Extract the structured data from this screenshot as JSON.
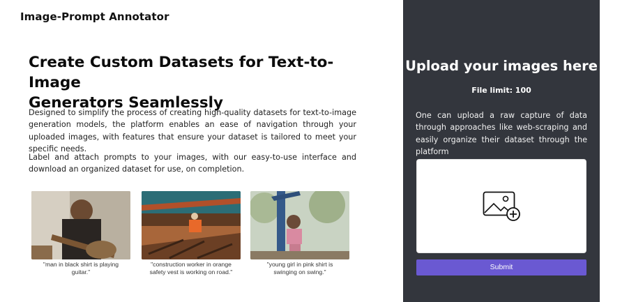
{
  "app": {
    "title": "Image-Prompt Annotator"
  },
  "hero": {
    "headline_line1": "Create Custom Datasets for Text-to-Image",
    "headline_line2": "Generators Seamlessly",
    "paragraph1": "Designed to simplify the process of creating high-quality datasets for text-to-image generation models, the platform enables an ease of navigation through your uploaded images, with features that ensure your dataset is tailored to meet your specific needs.",
    "paragraph2": "Label and attach prompts to your images, with our easy-to-use interface and download an organized dataset for use, on completion."
  },
  "examples": [
    {
      "caption_line1": "\"man in black shirt is playing",
      "caption_line2": "guitar.\""
    },
    {
      "caption_line1": "\"construction worker in orange",
      "caption_line2": "safety vest is working on road.\""
    },
    {
      "caption_line1": "\"young girl in pink shirt is",
      "caption_line2": "swinging on swing.\""
    }
  ],
  "upload": {
    "title": "Upload your images here",
    "file_limit": "File limit: 100",
    "description": "One can upload a raw capture of data through approaches like web-scraping and easily organize their dataset through the platform",
    "dropzone_icon": "add-image-icon",
    "submit_label": "Submit"
  },
  "colors": {
    "panel_background": "#33363d",
    "submit_button": "#6a59d2",
    "page_background": "#ffffff"
  }
}
